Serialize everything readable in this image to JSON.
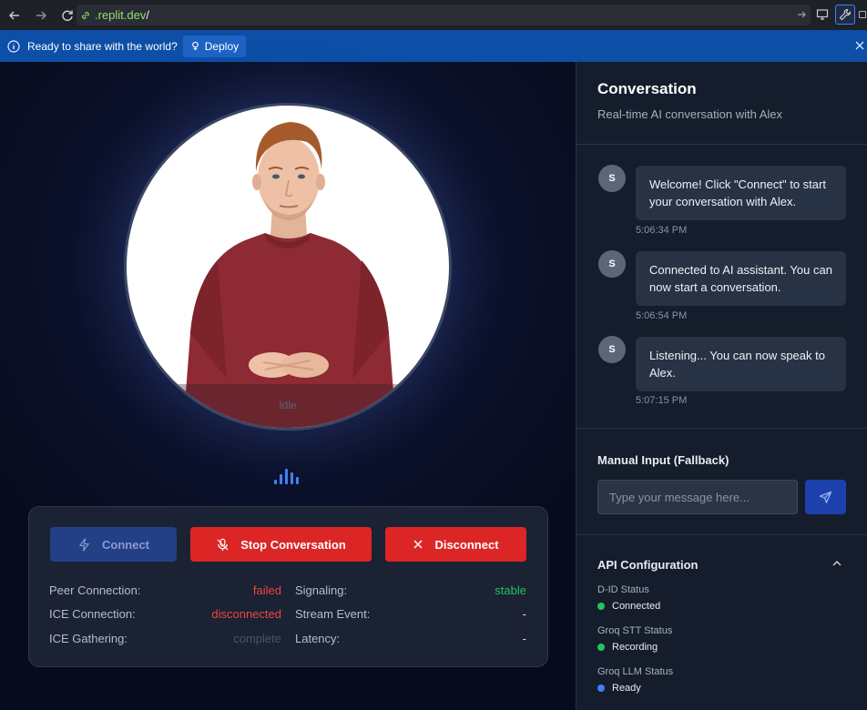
{
  "browser": {
    "url_domain": ".replit.dev",
    "url_path": "/"
  },
  "banner": {
    "message": "Ready to share with the world?",
    "deploy_label": "Deploy"
  },
  "video": {
    "status_label": "Idle"
  },
  "controls": {
    "connect_label": "Connect",
    "stop_label": "Stop Conversation",
    "disconnect_label": "Disconnect"
  },
  "stats": {
    "peer_connection": {
      "label": "Peer Connection:",
      "value": "failed"
    },
    "ice_connection": {
      "label": "ICE Connection:",
      "value": "disconnected"
    },
    "ice_gathering": {
      "label": "ICE Gathering:",
      "value": "complete"
    },
    "signaling": {
      "label": "Signaling:",
      "value": "stable"
    },
    "stream_event": {
      "label": "Stream Event:",
      "value": "-"
    },
    "latency": {
      "label": "Latency:",
      "value": "-"
    }
  },
  "conversation": {
    "title": "Conversation",
    "subtitle": "Real-time AI conversation with Alex",
    "messages": [
      {
        "avatar": "S",
        "text": "Welcome! Click \"Connect\" to start your conversation with Alex.",
        "time": "5:06:34 PM"
      },
      {
        "avatar": "S",
        "text": "Connected to AI assistant. You can now start a conversation.",
        "time": "5:06:54 PM"
      },
      {
        "avatar": "S",
        "text": "Listening... You can now speak to Alex.",
        "time": "5:07:15 PM"
      }
    ]
  },
  "manual_input": {
    "title": "Manual Input (Fallback)",
    "placeholder": "Type your message here..."
  },
  "api_config": {
    "title": "API Configuration",
    "items": [
      {
        "label": "D-ID Status",
        "status": "Connected",
        "color": "#22c55e"
      },
      {
        "label": "Groq STT Status",
        "status": "Recording",
        "color": "#22c55e"
      },
      {
        "label": "Groq LLM Status",
        "status": "Ready",
        "color": "#3b82f6"
      }
    ]
  },
  "colors": {
    "danger": "#dc2626",
    "error_text": "#ef4444",
    "success_text": "#22c55e",
    "muted_text": "#4b5567",
    "accent": "#3b82f6"
  }
}
